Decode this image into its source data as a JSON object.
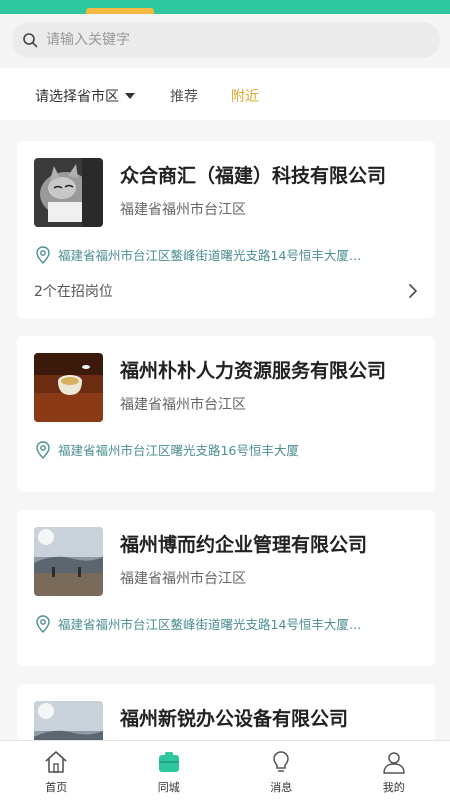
{
  "search": {
    "placeholder": "请输入关键字"
  },
  "filters": {
    "region_label": "请选择省市区",
    "tabs": [
      "推荐",
      "附近"
    ]
  },
  "companies": [
    {
      "name": "众合商汇（福建）科技有限公司",
      "region": "福建省福州市台江区",
      "address": "福建省福州市台江区鳌峰街道曙光支路14号恒丰大厦…",
      "jobs": "2个在招岗位",
      "thumb_icon": "cat-photo"
    },
    {
      "name": "福州朴朴人力资源服务有限公司",
      "region": "福建省福州市台江区",
      "address": "福建省福州市台江区曙光支路16号恒丰大厦",
      "thumb_icon": "teacup-photo"
    },
    {
      "name": "福州博而约企业管理有限公司",
      "region": "福建省福州市台江区",
      "address": "福建省福州市台江区鳌峰街道曙光支路14号恒丰大厦…",
      "thumb_icon": "landscape-photo"
    },
    {
      "name": "福州新锐办公设备有限公司",
      "thumb_icon": "landscape-photo"
    }
  ],
  "nav": [
    {
      "label": "首页",
      "icon": "home-icon"
    },
    {
      "label": "同城",
      "icon": "briefcase-icon"
    },
    {
      "label": "消息",
      "icon": "lightbulb-icon"
    },
    {
      "label": "我的",
      "icon": "user-icon"
    }
  ],
  "colors": {
    "brand": "#2ec7a0",
    "accent": "#e2a52c",
    "address": "#4c8f91"
  }
}
